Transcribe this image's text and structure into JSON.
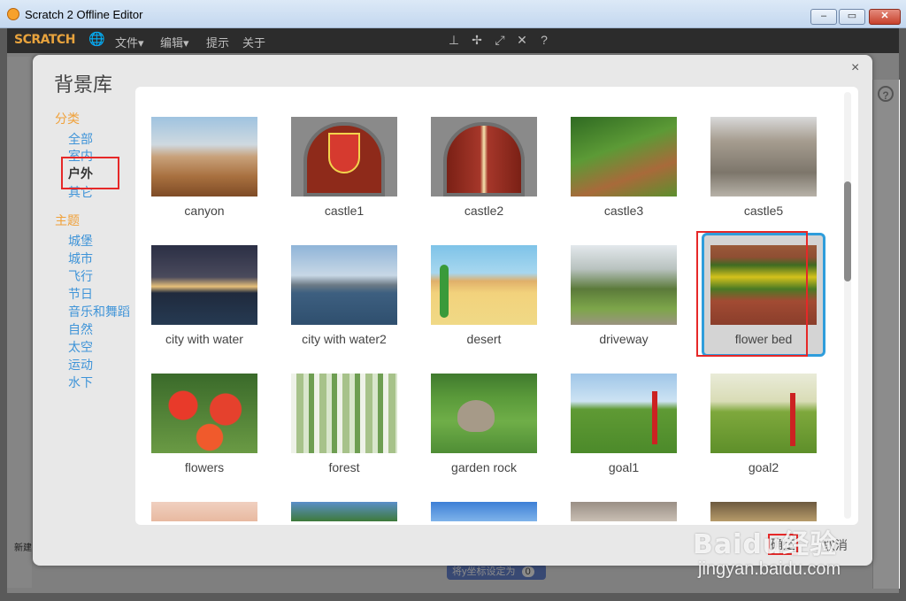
{
  "window": {
    "title": "Scratch 2 Offline Editor",
    "min": "–",
    "max": "▭",
    "close": "✕"
  },
  "menubar": {
    "logo": "SCRATCH",
    "items": [
      "文件▾",
      "编辑▾",
      "提示",
      "关于"
    ]
  },
  "dialog": {
    "title": "背景库",
    "close": "×",
    "categories_header": "分类",
    "categories": [
      "全部",
      "室内",
      "户外",
      "其它"
    ],
    "selected_category": "户外",
    "themes_header": "主题",
    "themes": [
      "城堡",
      "城市",
      "飞行",
      "节日",
      "音乐和舞蹈",
      "自然",
      "太空",
      "运动",
      "水下"
    ],
    "backdrops": [
      "canyon",
      "castle1",
      "castle2",
      "castle3",
      "castle5",
      "city with water",
      "city with water2",
      "desert",
      "driveway",
      "flower bed",
      "flowers",
      "forest",
      "garden rock",
      "goal1",
      "goal2"
    ],
    "selected_backdrop": "flower bed",
    "ok_label": "确定",
    "cancel_label": "取消"
  },
  "background": {
    "new_label": "新建",
    "set_y_label": "将y坐标设定为",
    "set_y_value": "0"
  },
  "watermark": {
    "main": "Baidu经验",
    "sub": "jingyan.baidu.com"
  }
}
